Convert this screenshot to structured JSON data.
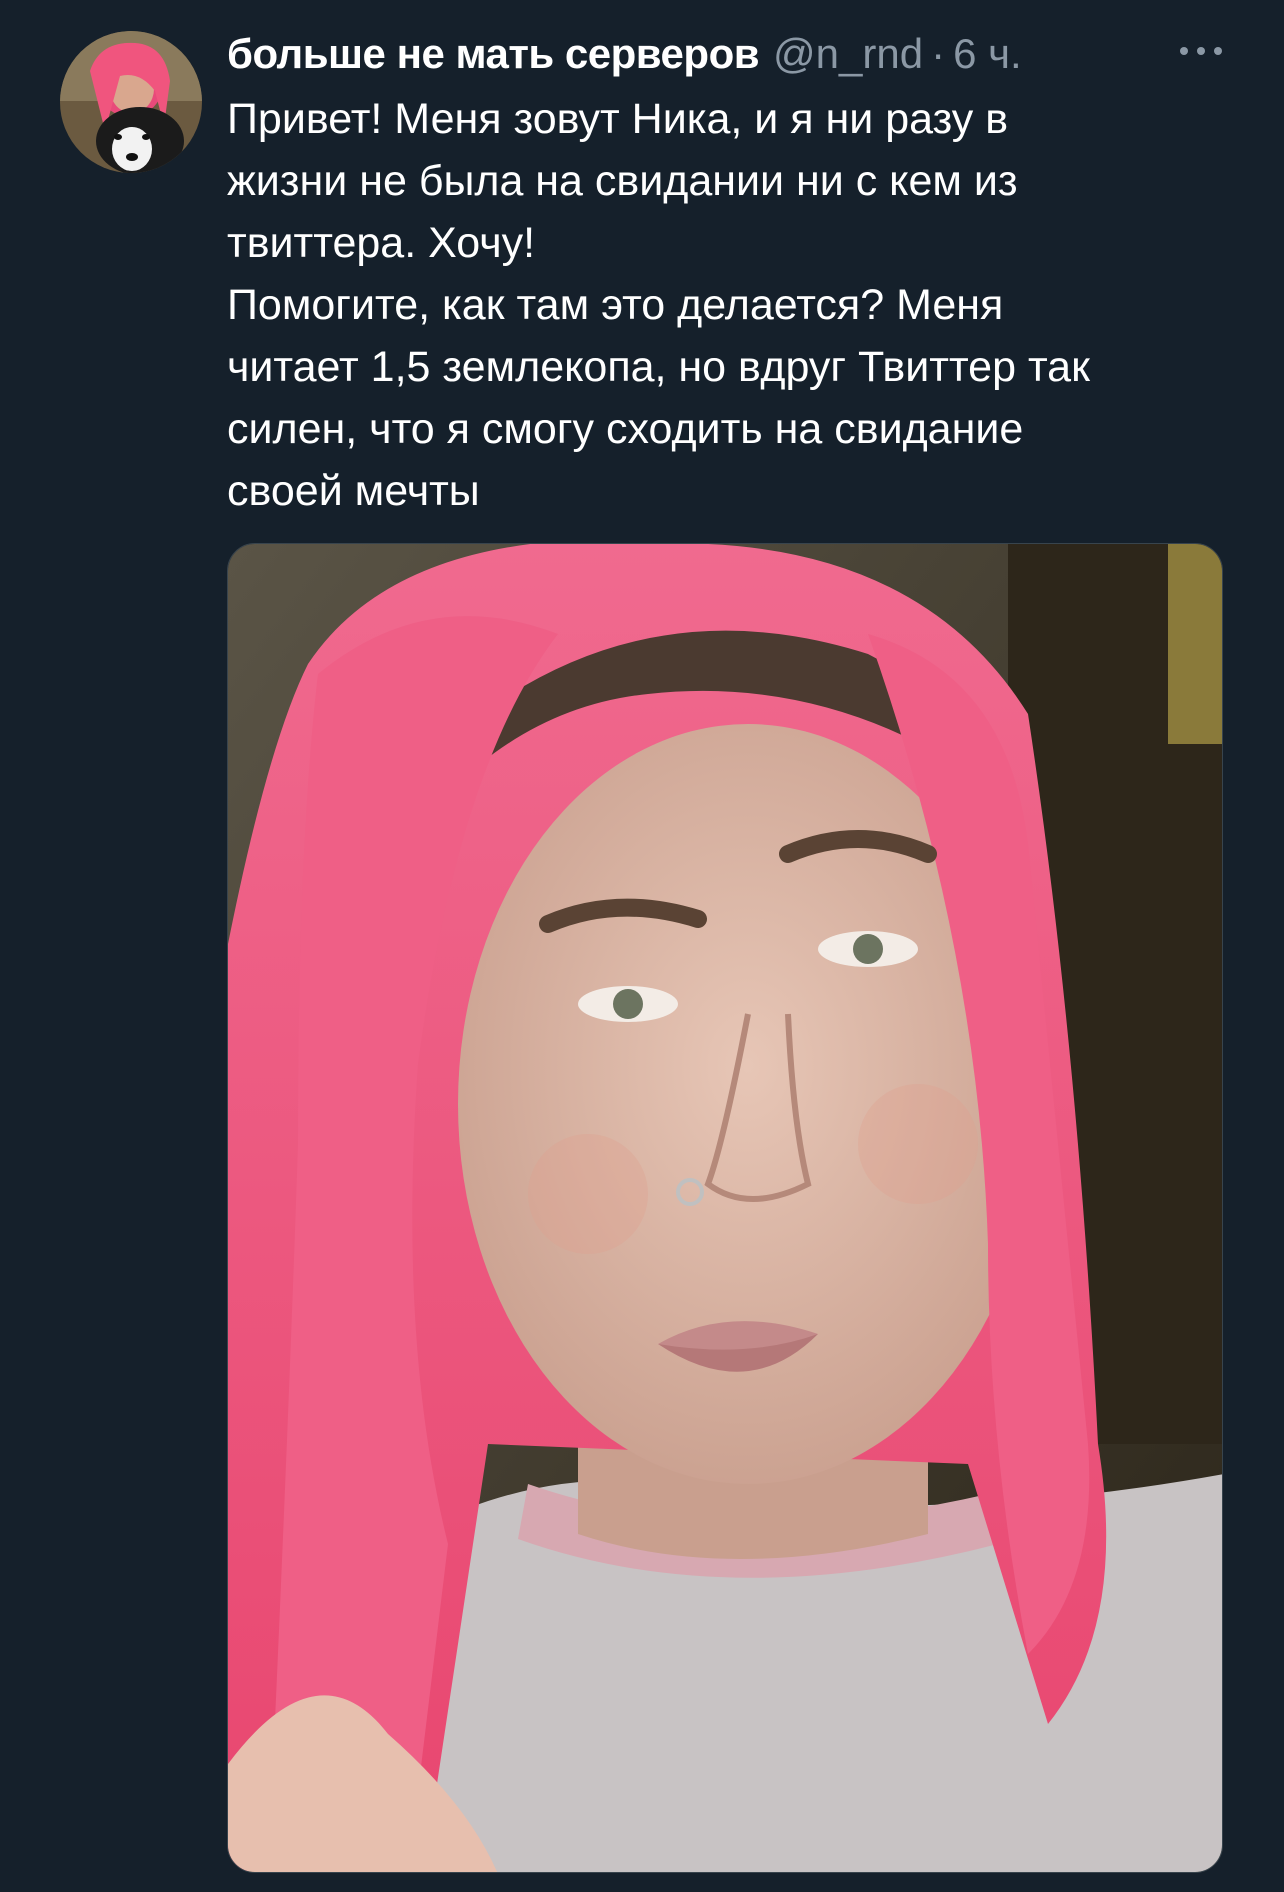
{
  "tweet": {
    "author": {
      "display_name": "больше не мать серверов",
      "handle": "@n_rnd",
      "separator": "·",
      "time": "6 ч."
    },
    "menu_icon": "more-horizontal-icon",
    "text_lines": [
      "Привет! Меня зовут Ника, и я ни разу в",
      "жизни не была на свидании ни с кем из",
      "твиттера. Хочу!",
      "Помогите, как там это делается? Меня",
      "читает 1,5 землекопа, но вдруг Твиттер так",
      "силен, что я смогу сходить на свидание",
      "своей мечты"
    ]
  },
  "colors": {
    "background": "#15202b",
    "primary_text": "#ffffff",
    "secondary_text": "#8b98a5",
    "hair": "#f0557e"
  }
}
